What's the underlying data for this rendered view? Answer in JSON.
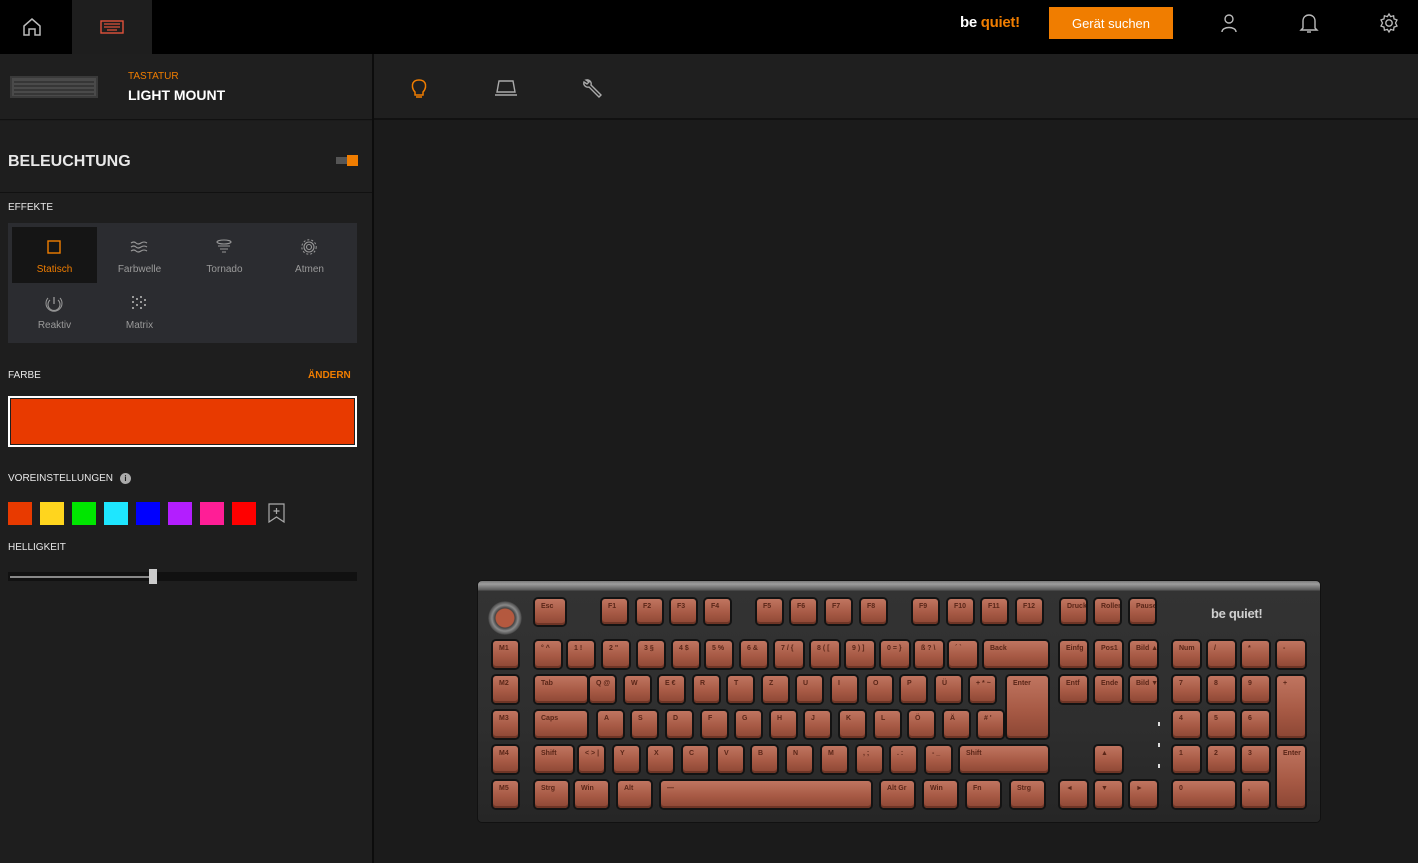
{
  "topbar": {
    "brand_prefix": "be",
    "brand_suffix": "quiet!",
    "find_device_label": "Gerät suchen",
    "icons": [
      "home-icon",
      "keyboard-icon",
      "user-icon",
      "bell-icon",
      "gear-icon"
    ]
  },
  "device": {
    "category": "TASTATUR",
    "name": "LIGHT MOUNT"
  },
  "modes": [
    "bulb-icon",
    "keyboard-stand-icon",
    "wrench-icon"
  ],
  "lighting": {
    "title": "BELEUCHTUNG",
    "enabled": true,
    "effects_label": "EFFEKTE",
    "effects": [
      {
        "label": "Statisch",
        "icon": "square-icon",
        "active": true
      },
      {
        "label": "Farbwelle",
        "icon": "wave-icon",
        "active": false
      },
      {
        "label": "Tornado",
        "icon": "tornado-icon",
        "active": false
      },
      {
        "label": "Atmen",
        "icon": "breath-icon",
        "active": false
      },
      {
        "label": "Reaktiv",
        "icon": "reactive-icon",
        "active": false
      },
      {
        "label": "Matrix",
        "icon": "matrix-icon",
        "active": false
      }
    ],
    "color_label": "FARBE",
    "change_label": "ÄNDERN",
    "current_color": "#e83a00",
    "presets_label": "VOREINSTELLUNGEN",
    "presets": [
      "#e83a00",
      "#ffd51e",
      "#00e600",
      "#1ee6ff",
      "#0000ff",
      "#b31eff",
      "#ff1e96",
      "#ff0000"
    ],
    "brightness_label": "HELLIGKEIT",
    "brightness": 0.41
  },
  "keyboard": {
    "brand": "be quiet!",
    "rows": [
      [
        [
          "Esc"
        ],
        [
          "F1"
        ],
        [
          "F2"
        ],
        [
          "F3"
        ],
        [
          "F4"
        ],
        [
          "F5"
        ],
        [
          "F6"
        ],
        [
          "F7"
        ],
        [
          "F8"
        ],
        [
          "F9"
        ],
        [
          "F10"
        ],
        [
          "F11"
        ],
        [
          "F12"
        ],
        [
          "Druck"
        ],
        [
          "Rollen"
        ],
        [
          "Pause"
        ]
      ],
      [
        [
          "M1"
        ],
        [
          "° ^"
        ],
        [
          "1 !"
        ],
        [
          "2 \""
        ],
        [
          "3 §"
        ],
        [
          "4 $"
        ],
        [
          "5 %"
        ],
        [
          "6 &"
        ],
        [
          "7 / {"
        ],
        [
          "8 ( ["
        ],
        [
          "9 ) ]"
        ],
        [
          "0 = }"
        ],
        [
          "ß ? \\"
        ],
        [
          "´ `"
        ],
        [
          "Back"
        ],
        [
          "Einfg"
        ],
        [
          "Pos1"
        ],
        [
          "Bild ▲"
        ],
        [
          "Num"
        ],
        [
          "/"
        ],
        [
          "*"
        ],
        [
          "-"
        ]
      ],
      [
        [
          "M2"
        ],
        [
          "Tab"
        ],
        [
          "Q @"
        ],
        [
          "W"
        ],
        [
          "E €"
        ],
        [
          "R"
        ],
        [
          "T"
        ],
        [
          "Z"
        ],
        [
          "U"
        ],
        [
          "I"
        ],
        [
          "O"
        ],
        [
          "P"
        ],
        [
          "Ü"
        ],
        [
          "+ * ~"
        ],
        [
          "Enter"
        ],
        [
          "Entf"
        ],
        [
          "Ende"
        ],
        [
          "Bild ▼"
        ],
        [
          "7"
        ],
        [
          "8"
        ],
        [
          "9"
        ],
        [
          "+"
        ]
      ],
      [
        [
          "M3"
        ],
        [
          "Caps"
        ],
        [
          "A"
        ],
        [
          "S"
        ],
        [
          "D"
        ],
        [
          "F"
        ],
        [
          "G"
        ],
        [
          "H"
        ],
        [
          "J"
        ],
        [
          "K"
        ],
        [
          "L"
        ],
        [
          "Ö"
        ],
        [
          "Ä"
        ],
        [
          "# '"
        ],
        [
          "4"
        ],
        [
          "5"
        ],
        [
          "6"
        ]
      ],
      [
        [
          "M4"
        ],
        [
          "Shift"
        ],
        [
          "< > |"
        ],
        [
          "Y"
        ],
        [
          "X"
        ],
        [
          "C"
        ],
        [
          "V"
        ],
        [
          "B"
        ],
        [
          "N"
        ],
        [
          "M"
        ],
        [
          ", ;"
        ],
        [
          ". :"
        ],
        [
          "- _"
        ],
        [
          "Shift"
        ],
        [
          "▲"
        ],
        [
          "1"
        ],
        [
          "2"
        ],
        [
          "3"
        ],
        [
          "Enter"
        ]
      ],
      [
        [
          "M5"
        ],
        [
          "Strg"
        ],
        [
          "Win"
        ],
        [
          "Alt"
        ],
        [
          "—"
        ],
        [
          "Alt Gr"
        ],
        [
          "Win"
        ],
        [
          "Fn"
        ],
        [
          "Strg"
        ],
        [
          "◄"
        ],
        [
          "▼"
        ],
        [
          "►"
        ],
        [
          "0"
        ],
        [
          ","
        ]
      ]
    ]
  }
}
